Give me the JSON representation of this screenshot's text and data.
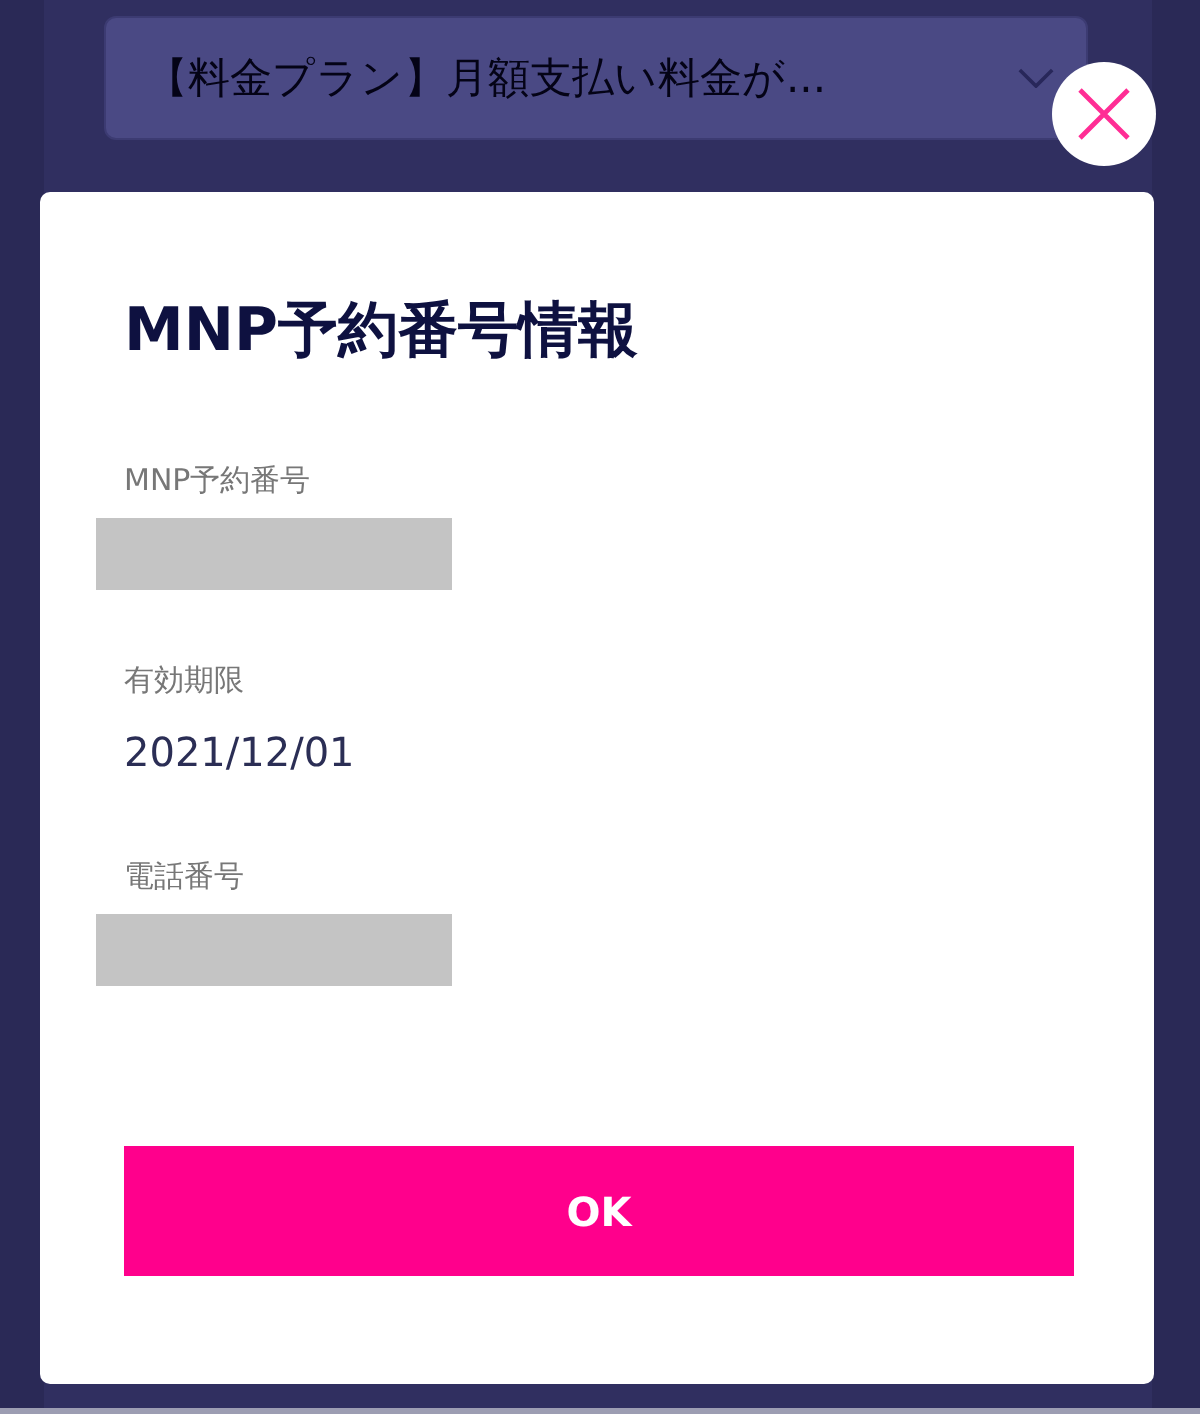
{
  "page": {
    "accordion": {
      "title": "【料金プラン】月額支払い料金が...",
      "expanded": false
    }
  },
  "dialog": {
    "title": "MNP予約番号情報",
    "fields": [
      {
        "label": "MNP予約番号",
        "redacted": true
      },
      {
        "label": "有効期限",
        "value": "2021/12/01",
        "redacted": false
      },
      {
        "label": "電話番号",
        "redacted": true
      }
    ],
    "button": "OK"
  }
}
